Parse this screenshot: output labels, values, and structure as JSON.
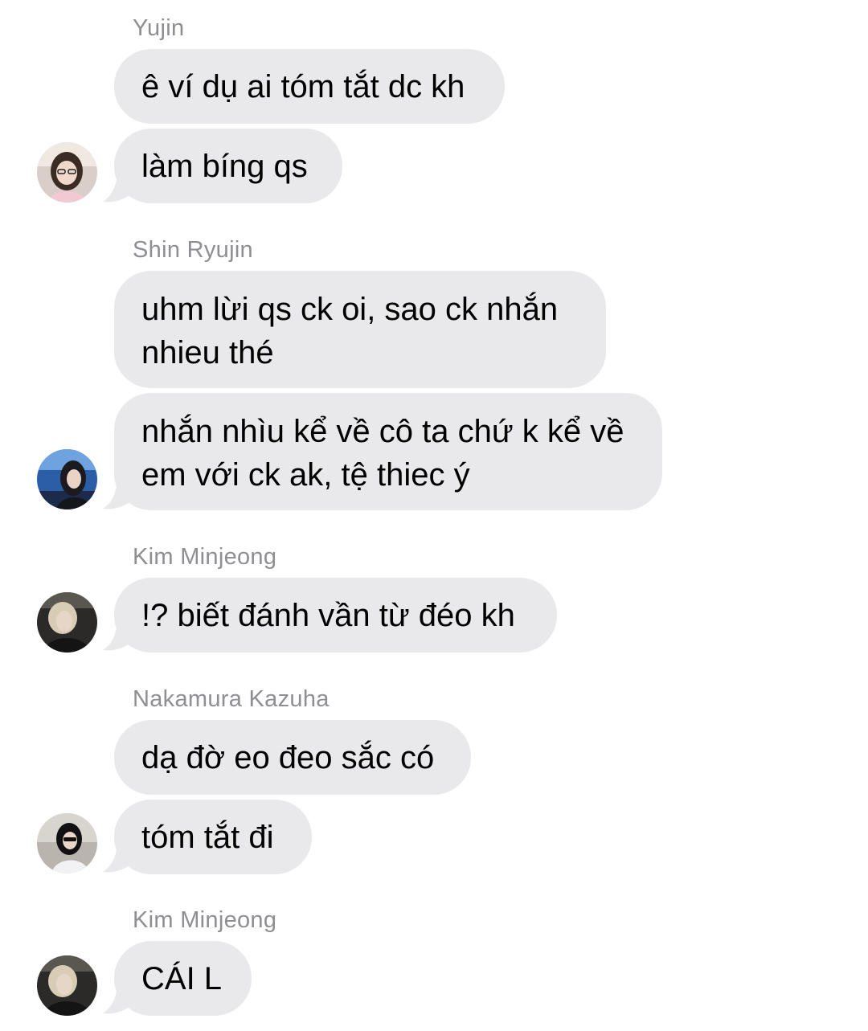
{
  "messages": [
    {
      "sender": "Yujin",
      "texts": [
        "ê ví dụ ai tóm tắt dc kh",
        "làm bíng qs"
      ]
    },
    {
      "sender": "Shin Ryujin",
      "texts": [
        [
          "uhm lừi qs ck oi, sao ck nhắn",
          "nhieu thé"
        ],
        [
          "nhắn nhìu kể về cô ta chứ k kể về",
          "em với ck ak, tệ thiec ý"
        ]
      ]
    },
    {
      "sender": "Kim Minjeong",
      "texts": [
        "!? biết đánh vần từ đéo kh"
      ]
    },
    {
      "sender": "Nakamura Kazuha",
      "texts": [
        "dạ đờ eo đeo sắc có",
        "tóm tắt đi"
      ]
    },
    {
      "sender": "Kim Minjeong",
      "texts": [
        "CÁI L"
      ]
    }
  ],
  "colors": {
    "bubble": "#e9e9eb",
    "sender_name": "#8e8e93",
    "text": "#000000",
    "background": "#ffffff"
  },
  "avatars": [
    "avatar-yujin",
    "avatar-shin-ryujin",
    "avatar-kim-minjeong",
    "avatar-nakamura-kazuha",
    "avatar-kim-minjeong"
  ]
}
